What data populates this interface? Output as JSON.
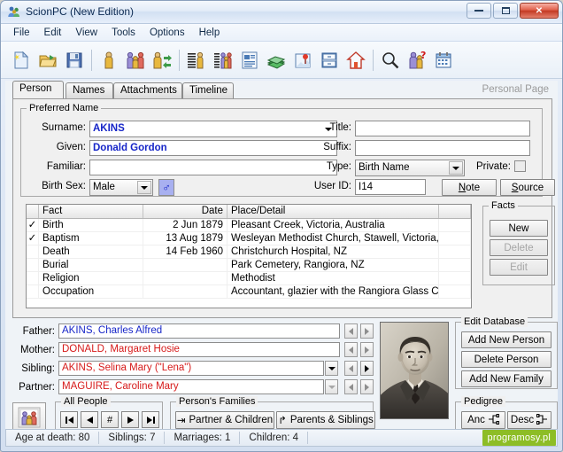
{
  "window": {
    "title": "ScionPC (New Edition)",
    "icon": "people-icon",
    "buttons": {
      "minimize": "—",
      "maximize": "❐",
      "close": "✕"
    }
  },
  "menu": {
    "items": [
      "File",
      "Edit",
      "View",
      "Tools",
      "Options",
      "Help"
    ]
  },
  "toolbar": {
    "items": [
      {
        "name": "new-file-icon"
      },
      {
        "name": "open-folder-icon"
      },
      {
        "name": "save-disk-icon"
      },
      {
        "name": "separator"
      },
      {
        "name": "person-icon"
      },
      {
        "name": "family-group-icon"
      },
      {
        "name": "person-swap-icon"
      },
      {
        "name": "separator"
      },
      {
        "name": "person-list-icon"
      },
      {
        "name": "family-list-icon"
      },
      {
        "name": "report-document-icon"
      },
      {
        "name": "books-icon"
      },
      {
        "name": "pin-note-icon"
      },
      {
        "name": "file-cabinet-icon"
      },
      {
        "name": "home-icon"
      },
      {
        "name": "separator"
      },
      {
        "name": "search-magnifier-icon"
      },
      {
        "name": "person-query-icon"
      },
      {
        "name": "calendar-icon"
      }
    ]
  },
  "tabs": {
    "items": [
      "Person",
      "Names",
      "Attachments",
      "Timeline"
    ],
    "active": "Person",
    "right_label": "Personal Page"
  },
  "preferred_name": {
    "legend": "Preferred Name",
    "surname": {
      "label": "Surname:",
      "value": "AKINS"
    },
    "given": {
      "label": "Given:",
      "value": "Donald Gordon"
    },
    "familiar": {
      "label": "Familiar:",
      "value": ""
    },
    "birth_sex": {
      "label": "Birth Sex:",
      "value": "Male",
      "symbol": "♂"
    },
    "title": {
      "label": "Title:",
      "value": ""
    },
    "suffix": {
      "label": "Suffix:",
      "value": ""
    },
    "type": {
      "label": "Type:",
      "value": "Birth Name"
    },
    "private": {
      "label": "Private:",
      "checked": false
    },
    "user_id": {
      "label": "User ID:",
      "value": "I14"
    },
    "note_button": "Note",
    "source_button": "Source"
  },
  "facts": {
    "columns": [
      "",
      "Fact",
      "Date",
      "Place/Detail",
      ""
    ],
    "rows": [
      {
        "check": "✓",
        "fact": "Birth",
        "date": "2 Jun 1879",
        "place": "Pleasant Creek, Victoria, Australia"
      },
      {
        "check": "✓",
        "fact": "Baptism",
        "date": "13 Aug 1879",
        "place": "Wesleyan Methodist Church, Stawell, Victoria, Australia"
      },
      {
        "check": "",
        "fact": "Death",
        "date": "14 Feb 1960",
        "place": "Christchurch Hospital, NZ"
      },
      {
        "check": "",
        "fact": "Burial",
        "date": "",
        "place": "Park Cemetery, Rangiora, NZ"
      },
      {
        "check": "",
        "fact": "Religion",
        "date": "",
        "place": "Methodist"
      },
      {
        "check": "",
        "fact": "Occupation",
        "date": "",
        "place": "Accountant, glazier with the Rangiora Glass Company"
      }
    ],
    "panel": {
      "legend": "Facts",
      "new_button": "New",
      "delete_button": "Delete",
      "edit_button": "Edit"
    }
  },
  "relatives": [
    {
      "label": "Father:",
      "value": "AKINS, Charles Alfred",
      "sex": "m",
      "has_dropdown": false,
      "prev_enabled": false,
      "next_enabled": false
    },
    {
      "label": "Mother:",
      "value": "DONALD, Margaret Hosie",
      "sex": "f",
      "has_dropdown": false,
      "prev_enabled": false,
      "next_enabled": false
    },
    {
      "label": "Sibling:",
      "value": "AKINS, Selina Mary (\"Lena\")",
      "sex": "f",
      "has_dropdown": true,
      "prev_enabled": false,
      "next_enabled": true
    },
    {
      "label": "Partner:",
      "value": "MAGUIRE, Caroline Mary",
      "sex": "f",
      "has_dropdown": true,
      "prev_enabled": false,
      "next_enabled": false
    }
  ],
  "photo": {
    "name": "person-portrait-photo",
    "alt": "Portrait photograph of a man in a suit"
  },
  "edit_database": {
    "legend": "Edit Database",
    "buttons": [
      "Add New Person",
      "Delete Person",
      "Add New Family"
    ]
  },
  "all_people": {
    "legend": "All People",
    "buttons": [
      {
        "name": "first-person-button",
        "glyph": "⏮"
      },
      {
        "name": "previous-person-button",
        "glyph": "◀"
      },
      {
        "name": "goto-number-button",
        "glyph": "#"
      },
      {
        "name": "next-person-button",
        "glyph": "▶"
      },
      {
        "name": "last-person-button",
        "glyph": "⏭"
      }
    ]
  },
  "persons_families": {
    "legend": "Person's Families",
    "partner_children": "Partner & Children",
    "parents_siblings": "Parents & Siblings"
  },
  "pedigree": {
    "legend": "Pedigree",
    "ancestors": "Anc",
    "descendants": "Desc"
  },
  "family_icon_button": {
    "name": "family-group-button",
    "icon": "family-group-icon"
  },
  "statusbar": {
    "age_at_death": "Age at death: 80",
    "siblings": "Siblings: 7",
    "marriages": "Marriages: 1",
    "children": "Children: 4",
    "watermark": "programosy.pl"
  },
  "colors": {
    "male": "#1726c8",
    "female": "#d61a1a",
    "watermark_bg": "#8dbd26",
    "close_button": "#c33a23"
  }
}
